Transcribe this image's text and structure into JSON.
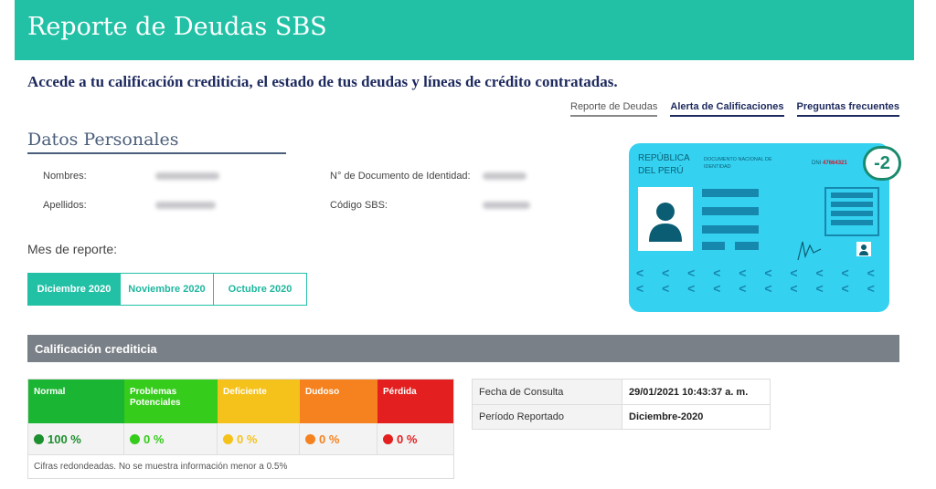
{
  "header": {
    "title": "Reporte de Deudas SBS"
  },
  "subtitle": "Accede a tu calificación crediticia, el estado de tus deudas y líneas de crédito contratadas.",
  "nav_links": [
    {
      "label": "Reporte de Deudas"
    },
    {
      "label": "Alerta de Calificaciones"
    },
    {
      "label": "Preguntas frecuentes"
    }
  ],
  "personal": {
    "heading": "Datos Personales",
    "nombres_label": "Nombres:",
    "apellidos_label": "Apellidos:",
    "doc_label": "N° de Documento de Identidad:",
    "sbs_label": "Código SBS:"
  },
  "month": {
    "label": "Mes de reporte:",
    "tabs": [
      "Diciembre 2020",
      "Noviembre 2020",
      "Octubre 2020"
    ],
    "selected": "Diciembre 2020"
  },
  "dni_card": {
    "republica": "REPÚBLICA DEL PERÚ",
    "doc_title": "DOCUMENTO NACIONAL DE IDENTIDAD",
    "dni_label": "DNI",
    "dni_number": "47664321",
    "badge": "-2",
    "chevrons_row": "< < < < < < < < < < < <"
  },
  "calificacion": {
    "title": "Calificación crediticia",
    "categories": [
      {
        "name": "Normal",
        "value": "100 %",
        "color": "#1bb534",
        "dot": "#1c8f2e"
      },
      {
        "name": "Problemas Potenciales",
        "value": "0 %",
        "color": "#36cc1c",
        "dot": "#36cc1c"
      },
      {
        "name": "Deficiente",
        "value": "0 %",
        "color": "#f5c21c",
        "dot": "#f5c21c"
      },
      {
        "name": "Dudoso",
        "value": "0 %",
        "color": "#f5821f",
        "dot": "#f5821f"
      },
      {
        "name": "Pérdida",
        "value": "0 %",
        "color": "#e41f1f",
        "dot": "#e41f1f"
      }
    ],
    "note": "Cifras redondeadas. No se muestra información menor a 0.5%"
  },
  "consulta": {
    "fecha_label": "Fecha de Consulta",
    "fecha_value": "29/01/2021 10:43:37 a. m.",
    "periodo_label": "Período Reportado",
    "periodo_value": "Diciembre-2020"
  },
  "colors": {
    "accent": "#22c1a6",
    "navy": "#1d2a5e",
    "gray_bar": "#7a8087"
  }
}
